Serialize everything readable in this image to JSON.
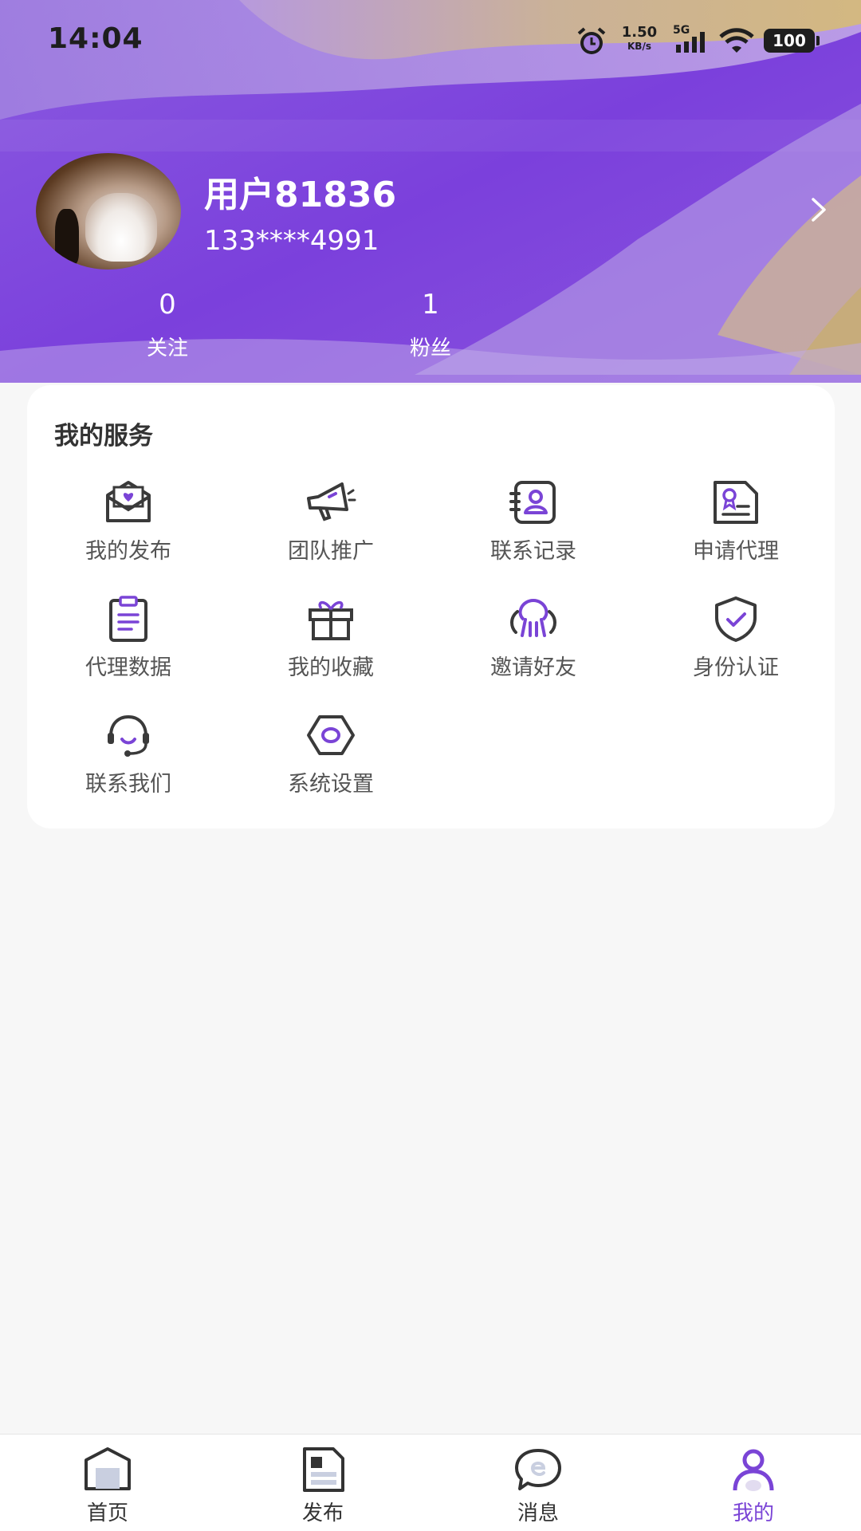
{
  "status_bar": {
    "time": "14:04",
    "net_speed_value": "1.50",
    "net_speed_unit": "KB/s",
    "network": "5G",
    "battery": "100"
  },
  "profile": {
    "username": "用户81836",
    "phone": "133****4991",
    "stats": [
      {
        "count": "0",
        "label": "关注"
      },
      {
        "count": "1",
        "label": "粉丝"
      }
    ]
  },
  "services": {
    "title": "我的服务",
    "items": [
      {
        "label": "我的发布",
        "icon": "envelope-heart-icon"
      },
      {
        "label": "团队推广",
        "icon": "megaphone-icon"
      },
      {
        "label": "联系记录",
        "icon": "contact-book-icon"
      },
      {
        "label": "申请代理",
        "icon": "certificate-icon"
      },
      {
        "label": "代理数据",
        "icon": "clipboard-icon"
      },
      {
        "label": "我的收藏",
        "icon": "gift-icon"
      },
      {
        "label": "邀请好友",
        "icon": "invite-people-icon"
      },
      {
        "label": "身份认证",
        "icon": "shield-check-icon"
      },
      {
        "label": "联系我们",
        "icon": "headset-icon"
      },
      {
        "label": "系统设置",
        "icon": "hexagon-settings-icon"
      }
    ]
  },
  "bottom_nav": {
    "items": [
      {
        "label": "首页",
        "icon": "home-icon"
      },
      {
        "label": "发布",
        "icon": "publish-icon"
      },
      {
        "label": "消息",
        "icon": "message-icon"
      },
      {
        "label": "我的",
        "icon": "profile-icon",
        "active": true
      }
    ]
  },
  "colors": {
    "accent": "#7a44d6",
    "header_purple": "#7a3fdc",
    "header_gold": "#d4b87a",
    "page_bg": "#f7f7f7",
    "icon_dark": "#3a3a3a"
  }
}
